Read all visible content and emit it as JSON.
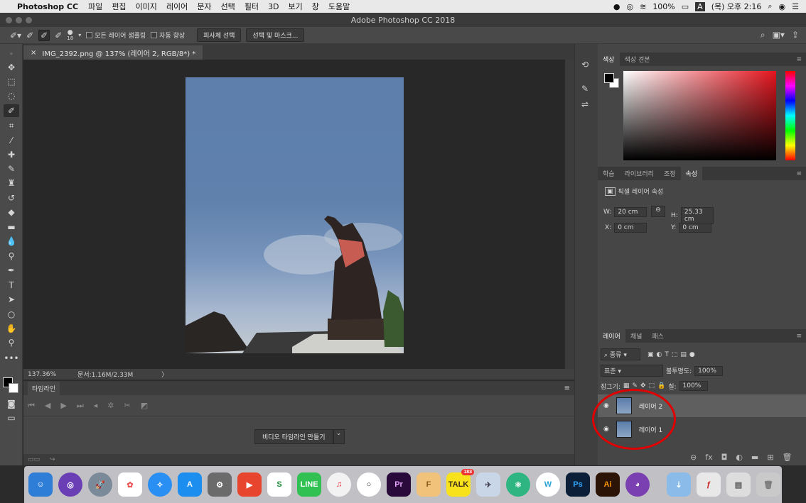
{
  "menubar": {
    "app_name": "Photoshop CC",
    "items": [
      "파일",
      "편집",
      "이미지",
      "레이어",
      "문자",
      "선택",
      "필터",
      "3D",
      "보기",
      "창",
      "도움말"
    ],
    "battery": "100%",
    "clock": "(목) 오후 2:16",
    "input": "A"
  },
  "window": {
    "title": "Adobe Photoshop CC 2018"
  },
  "options": {
    "brush_size": "18",
    "sample_all_layers": "모든 레이어 샘플링",
    "auto_enhance": "자동 향상",
    "select_subject": "피사체 선택",
    "select_mask": "선택 및 마스크..."
  },
  "document": {
    "tab": "IMG_2392.png @ 137% (레이어 2, RGB/8*) *",
    "close": "×"
  },
  "status": {
    "zoom": "137.36%",
    "doc": "문서:1.16M/2.33M",
    "arrow": "〉"
  },
  "timeline": {
    "title": "타임라인",
    "create": "비디오 타임라인 만들기"
  },
  "color_panel": {
    "tabs": [
      "색상",
      "색상 견본"
    ]
  },
  "props_panel": {
    "tabs": [
      "학습",
      "라이브러리",
      "조정",
      "속성"
    ],
    "active": "속성",
    "header": "픽셀 레이어 속성",
    "w_label": "W:",
    "w": "20 cm",
    "h_label": "H:",
    "h": "25.33 cm",
    "x_label": "X:",
    "x": "0 cm",
    "y_label": "Y:",
    "y": "0 cm"
  },
  "layers_panel": {
    "tabs": [
      "레이어",
      "채널",
      "패스"
    ],
    "filter": "종류",
    "blend": "표준",
    "opacity_label": "불투명도:",
    "opacity": "100%",
    "lock_label": "잠그기:",
    "fill_label": "칠:",
    "fill": "100%",
    "layers": [
      "레이어 2",
      "레이어 1"
    ]
  },
  "colors": {
    "annotation": "#e00000",
    "accent": "#e3141d"
  }
}
